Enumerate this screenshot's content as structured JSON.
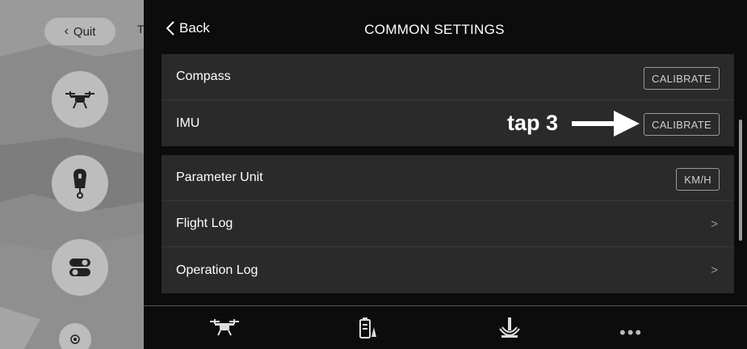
{
  "sidebar": {
    "quit_label": "Quit",
    "peek_letter": "T",
    "buttons": [
      {
        "icon": "drone-icon"
      },
      {
        "icon": "remote-controller-icon"
      },
      {
        "icon": "toggle-switches-icon"
      },
      {
        "icon": "target-icon"
      }
    ]
  },
  "header": {
    "back_label": "Back",
    "title": "COMMON SETTINGS"
  },
  "groups": [
    {
      "rows": [
        {
          "label": "Compass",
          "action": "CALIBRATE"
        },
        {
          "label": "IMU",
          "action": "CALIBRATE"
        }
      ]
    },
    {
      "rows": [
        {
          "label": "Parameter Unit",
          "action": "KM/H"
        },
        {
          "label": "Flight Log",
          "action": ">"
        },
        {
          "label": "Operation Log",
          "action": ">"
        }
      ]
    }
  ],
  "annotation": {
    "text": "tap 3"
  },
  "bottom_nav": [
    {
      "icon": "drone-icon"
    },
    {
      "icon": "battery-icon"
    },
    {
      "icon": "signal-icon"
    },
    {
      "icon": "more-icon",
      "text": "•••"
    }
  ],
  "colors": {
    "panel_bg": "#0c0c0c",
    "row_bg": "#2a2a2a",
    "sidebar_bg": "#8a8a8a"
  }
}
